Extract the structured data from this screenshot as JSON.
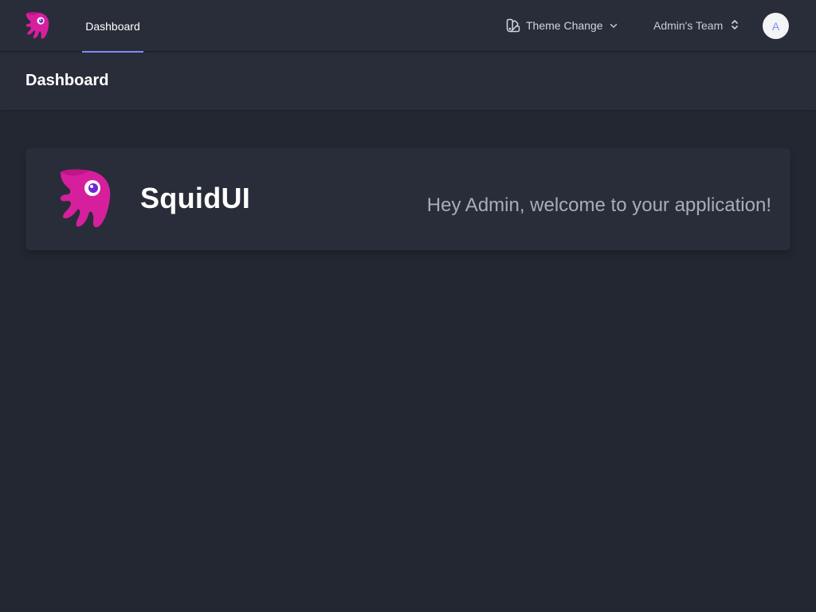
{
  "header": {
    "logo_icon": "squid-logo-icon",
    "nav": {
      "active_tab": "Dashboard"
    },
    "theme": {
      "label": "Theme Change",
      "icon": "swatch-icon",
      "chevron": "chevron-down-icon"
    },
    "team": {
      "label": "Admin's Team",
      "icon": "selector-icon"
    },
    "avatar": {
      "initial": "A"
    }
  },
  "page": {
    "title": "Dashboard"
  },
  "welcome_card": {
    "logo_icon": "squid-logo-icon",
    "brand": "SquidUI",
    "message": "Hey Admin, welcome to your application!"
  },
  "colors": {
    "background": "#232731",
    "surface": "#292d39",
    "accent": "#818cf8",
    "logo_magenta": "#d61f9d",
    "logo_eye": "#6d28d9"
  }
}
